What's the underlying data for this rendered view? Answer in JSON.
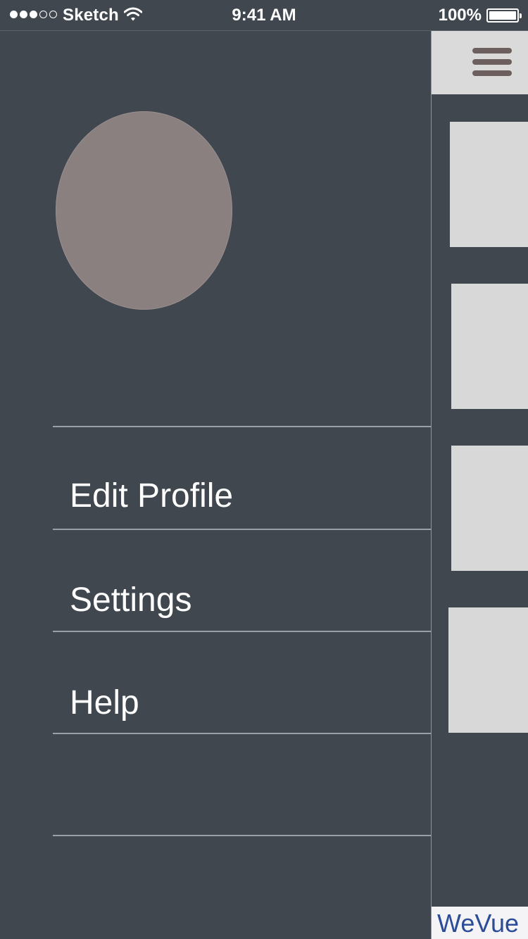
{
  "status_bar": {
    "carrier": "Sketch",
    "time": "9:41 AM",
    "battery_percent": "100%",
    "signal_bars_filled": 3,
    "signal_bars_total": 5,
    "battery_level": 1.0
  },
  "drawer": {
    "avatar_color": "#8b8080",
    "menu": [
      {
        "label": "Edit Profile"
      },
      {
        "label": "Settings"
      },
      {
        "label": "Help"
      },
      {
        "label": ""
      }
    ]
  },
  "main": {
    "menu_icon": "hamburger-menu-icon",
    "brand": "WeVue",
    "brand_color": "#2c4c98",
    "card_color": "#d8d8d8"
  },
  "theme": {
    "background": "#40474f",
    "text": "#ffffff"
  }
}
